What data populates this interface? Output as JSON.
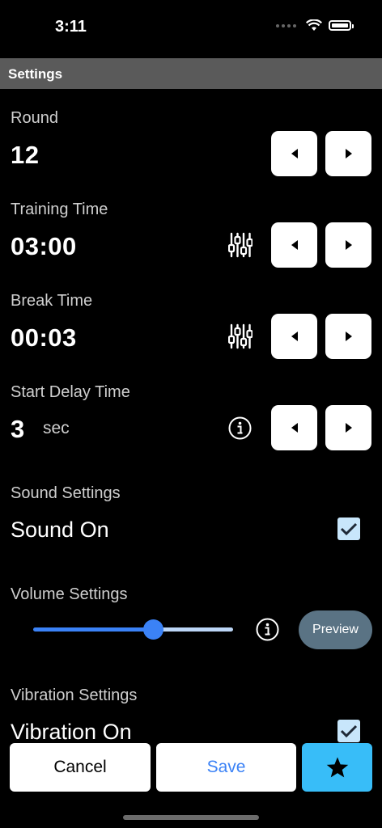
{
  "status": {
    "time": "3:11"
  },
  "header": {
    "title": "Settings"
  },
  "round": {
    "label": "Round",
    "value": "12"
  },
  "training": {
    "label": "Training Time",
    "value": "03:00"
  },
  "break": {
    "label": "Break Time",
    "value": "00:03"
  },
  "start_delay": {
    "label": "Start Delay Time",
    "value": "3",
    "unit": "sec"
  },
  "sound": {
    "section": "Sound Settings",
    "toggle_label": "Sound On",
    "checked": true
  },
  "volume": {
    "section": "Volume Settings",
    "level": 0.6,
    "preview_label": "Preview"
  },
  "vibration": {
    "section": "Vibration Settings",
    "toggle_label": "Vibration On",
    "checked": true
  },
  "footer": {
    "cancel": "Cancel",
    "save": "Save"
  },
  "colors": {
    "accent": "#3b82f6",
    "favorite_bg": "#38bdf8",
    "save_text": "#3b82f6"
  }
}
